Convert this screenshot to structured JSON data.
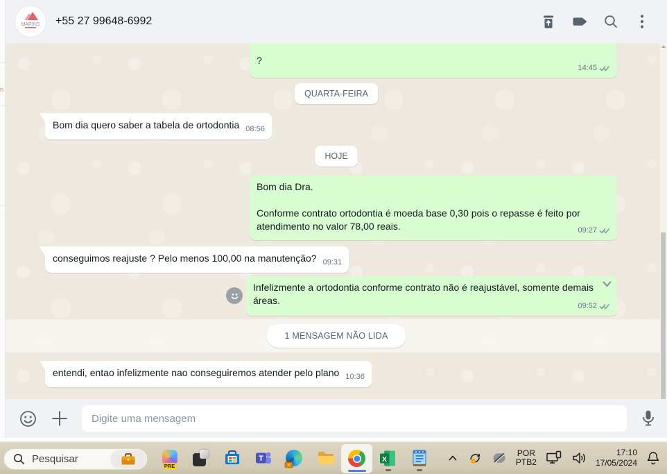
{
  "header": {
    "phone": "+55 27 99648-6992",
    "avatar_brand": "MARINS",
    "icons": [
      "delete-icon",
      "label-icon",
      "search-icon",
      "menu-kebab-icon"
    ]
  },
  "chat": {
    "dividers": {
      "wednesday": "QUARTA-FEIRA",
      "today": "HOJE"
    },
    "unread_label": "1 MENSAGEM NÃO LIDA",
    "messages": [
      {
        "direction": "out",
        "text": "?",
        "time": "14:45",
        "status": "delivered"
      },
      {
        "direction": "in",
        "text": "Bom dia quero saber a tabela de ortodontia",
        "time": "08:56"
      },
      {
        "direction": "out",
        "lines": [
          "Bom dia Dra.",
          "",
          "Conforme contrato ortodontia é moeda base 0,30 pois o repasse é feito por",
          "atendimento no valor 78,00 reais."
        ],
        "time": "09:27",
        "status": "delivered"
      },
      {
        "direction": "in",
        "text": "conseguimos reajuste ? Pelo menos 100,00 na manutenção?",
        "time": "09:31"
      },
      {
        "direction": "out",
        "lines": [
          "Infelizmente a ortodontia conforme contrato não é reajustável, somente demais",
          "áreas."
        ],
        "time": "09:52",
        "status": "delivered",
        "hover_controls": [
          "react-emoji-button",
          "message-menu-chevron"
        ]
      },
      {
        "direction": "in",
        "text": "entendi, entao infelizmente nao conseguiremos atender pelo plano",
        "time": "10:36"
      }
    ]
  },
  "composer": {
    "placeholder": "Digite uma mensagem",
    "icons": [
      "emoji-icon",
      "plus-icon",
      "mic-icon"
    ]
  },
  "taskbar": {
    "search_label": "Pesquisar",
    "search_highlight_icon": "briefcase-icon",
    "copilot_badge": "PRE",
    "apps": [
      "copilot",
      "task-view-squares",
      "microsoft-store",
      "teams",
      "edge-business",
      "file-explorer",
      "chrome",
      "excel",
      "notepad"
    ],
    "active_app": "chrome",
    "running_apps": [
      "excel",
      "notepad"
    ],
    "tray": {
      "language_line1": "POR",
      "language_line2": "PTB2",
      "time": "17:10",
      "date": "17/05/2024",
      "icons": [
        "chevron-up-icon",
        "sync-pending-icon",
        "slashed-status-icon",
        "network-display-icon",
        "volume-icon",
        "bell-icon"
      ]
    }
  },
  "colors": {
    "outgoing_bubble": "#d7fdd0",
    "incoming_bubble": "#ffffff",
    "chat_background": "#efe8df",
    "header_background": "#f0f2f5",
    "icon_gray": "#54656f",
    "tick_gray": "#8696a0",
    "taskbar_beige": "#d5cfbb",
    "active_underline": "#4a84d8"
  }
}
